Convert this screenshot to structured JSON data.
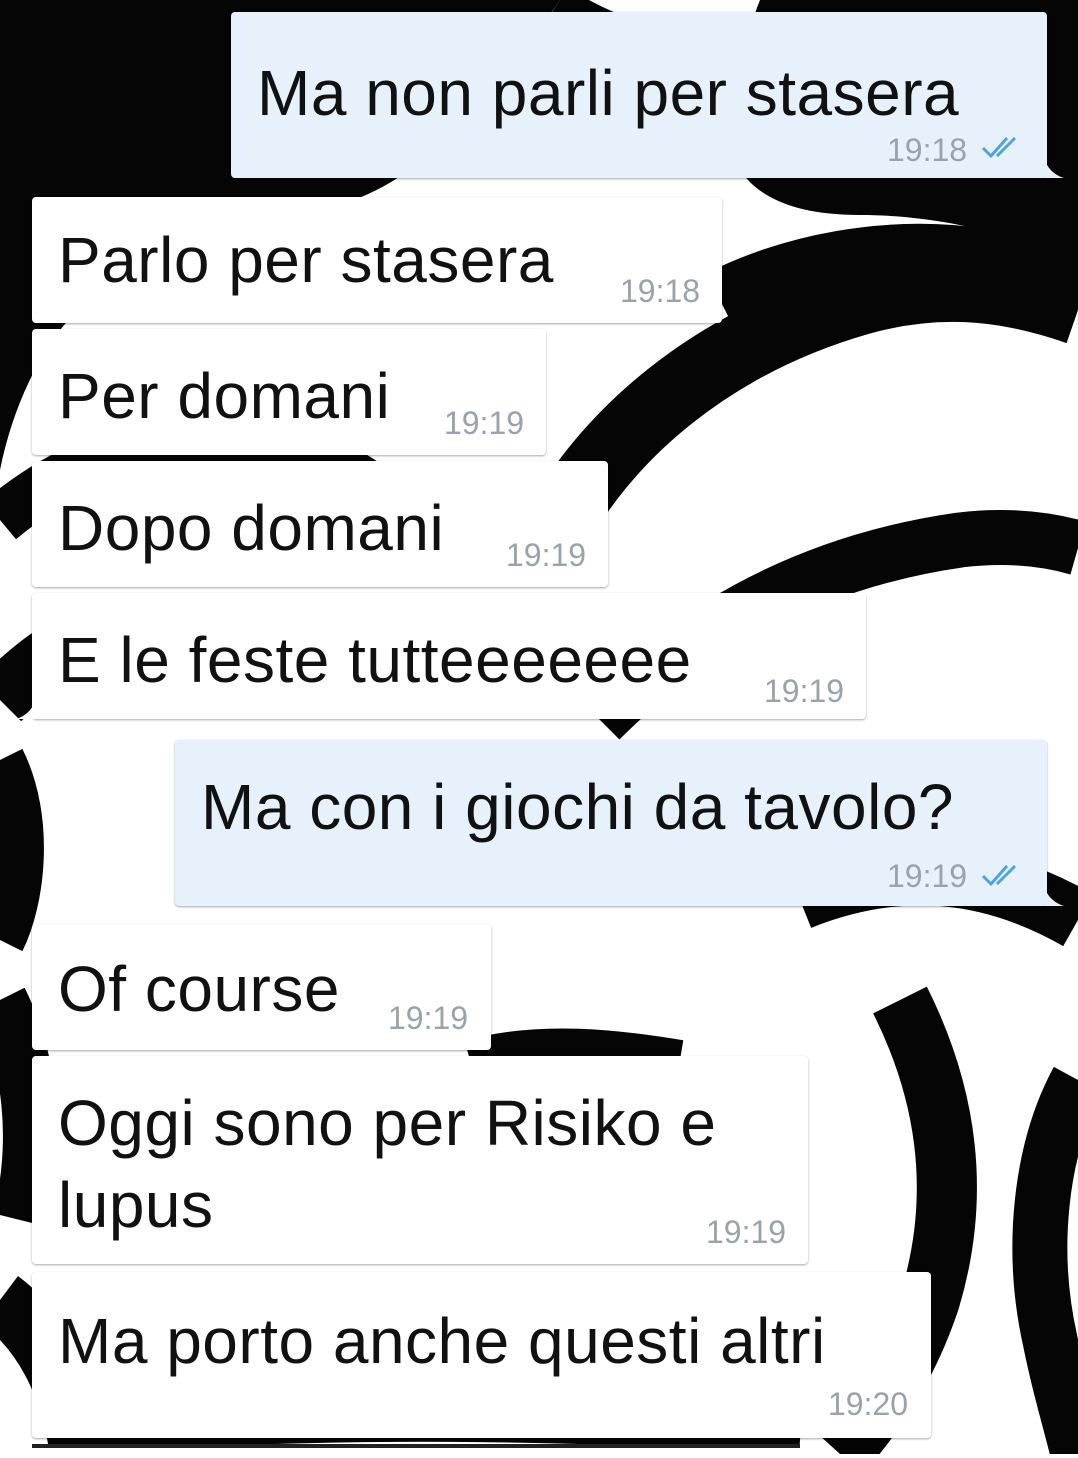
{
  "theme": {
    "incoming_bg": "#ffffff",
    "outgoing_bg": "#e6f1fb",
    "text_color": "#111111",
    "time_color": "#9aa3ab",
    "read_tick_color": "#4fa3e0"
  },
  "messages": [
    {
      "direction": "outgoing",
      "text": "Ma non parli per stasera",
      "time": "19:18",
      "status": "read-double-check-icon"
    },
    {
      "direction": "incoming",
      "text": "Parlo per stasera",
      "time": "19:18"
    },
    {
      "direction": "incoming",
      "text": "Per domani",
      "time": "19:19"
    },
    {
      "direction": "incoming",
      "text": "Dopo domani",
      "time": "19:19"
    },
    {
      "direction": "incoming",
      "text": "E le feste tutteeeeeee",
      "time": "19:19"
    },
    {
      "direction": "outgoing",
      "text": "Ma con i giochi da tavolo?",
      "time": "19:19",
      "status": "read-double-check-icon"
    },
    {
      "direction": "incoming",
      "text": "Of course",
      "time": "19:19"
    },
    {
      "direction": "incoming",
      "text": "Oggi sono per Risiko e lupus",
      "time": "19:19"
    },
    {
      "direction": "incoming",
      "text": "Ma porto anche questi altri",
      "time": "19:20"
    }
  ]
}
